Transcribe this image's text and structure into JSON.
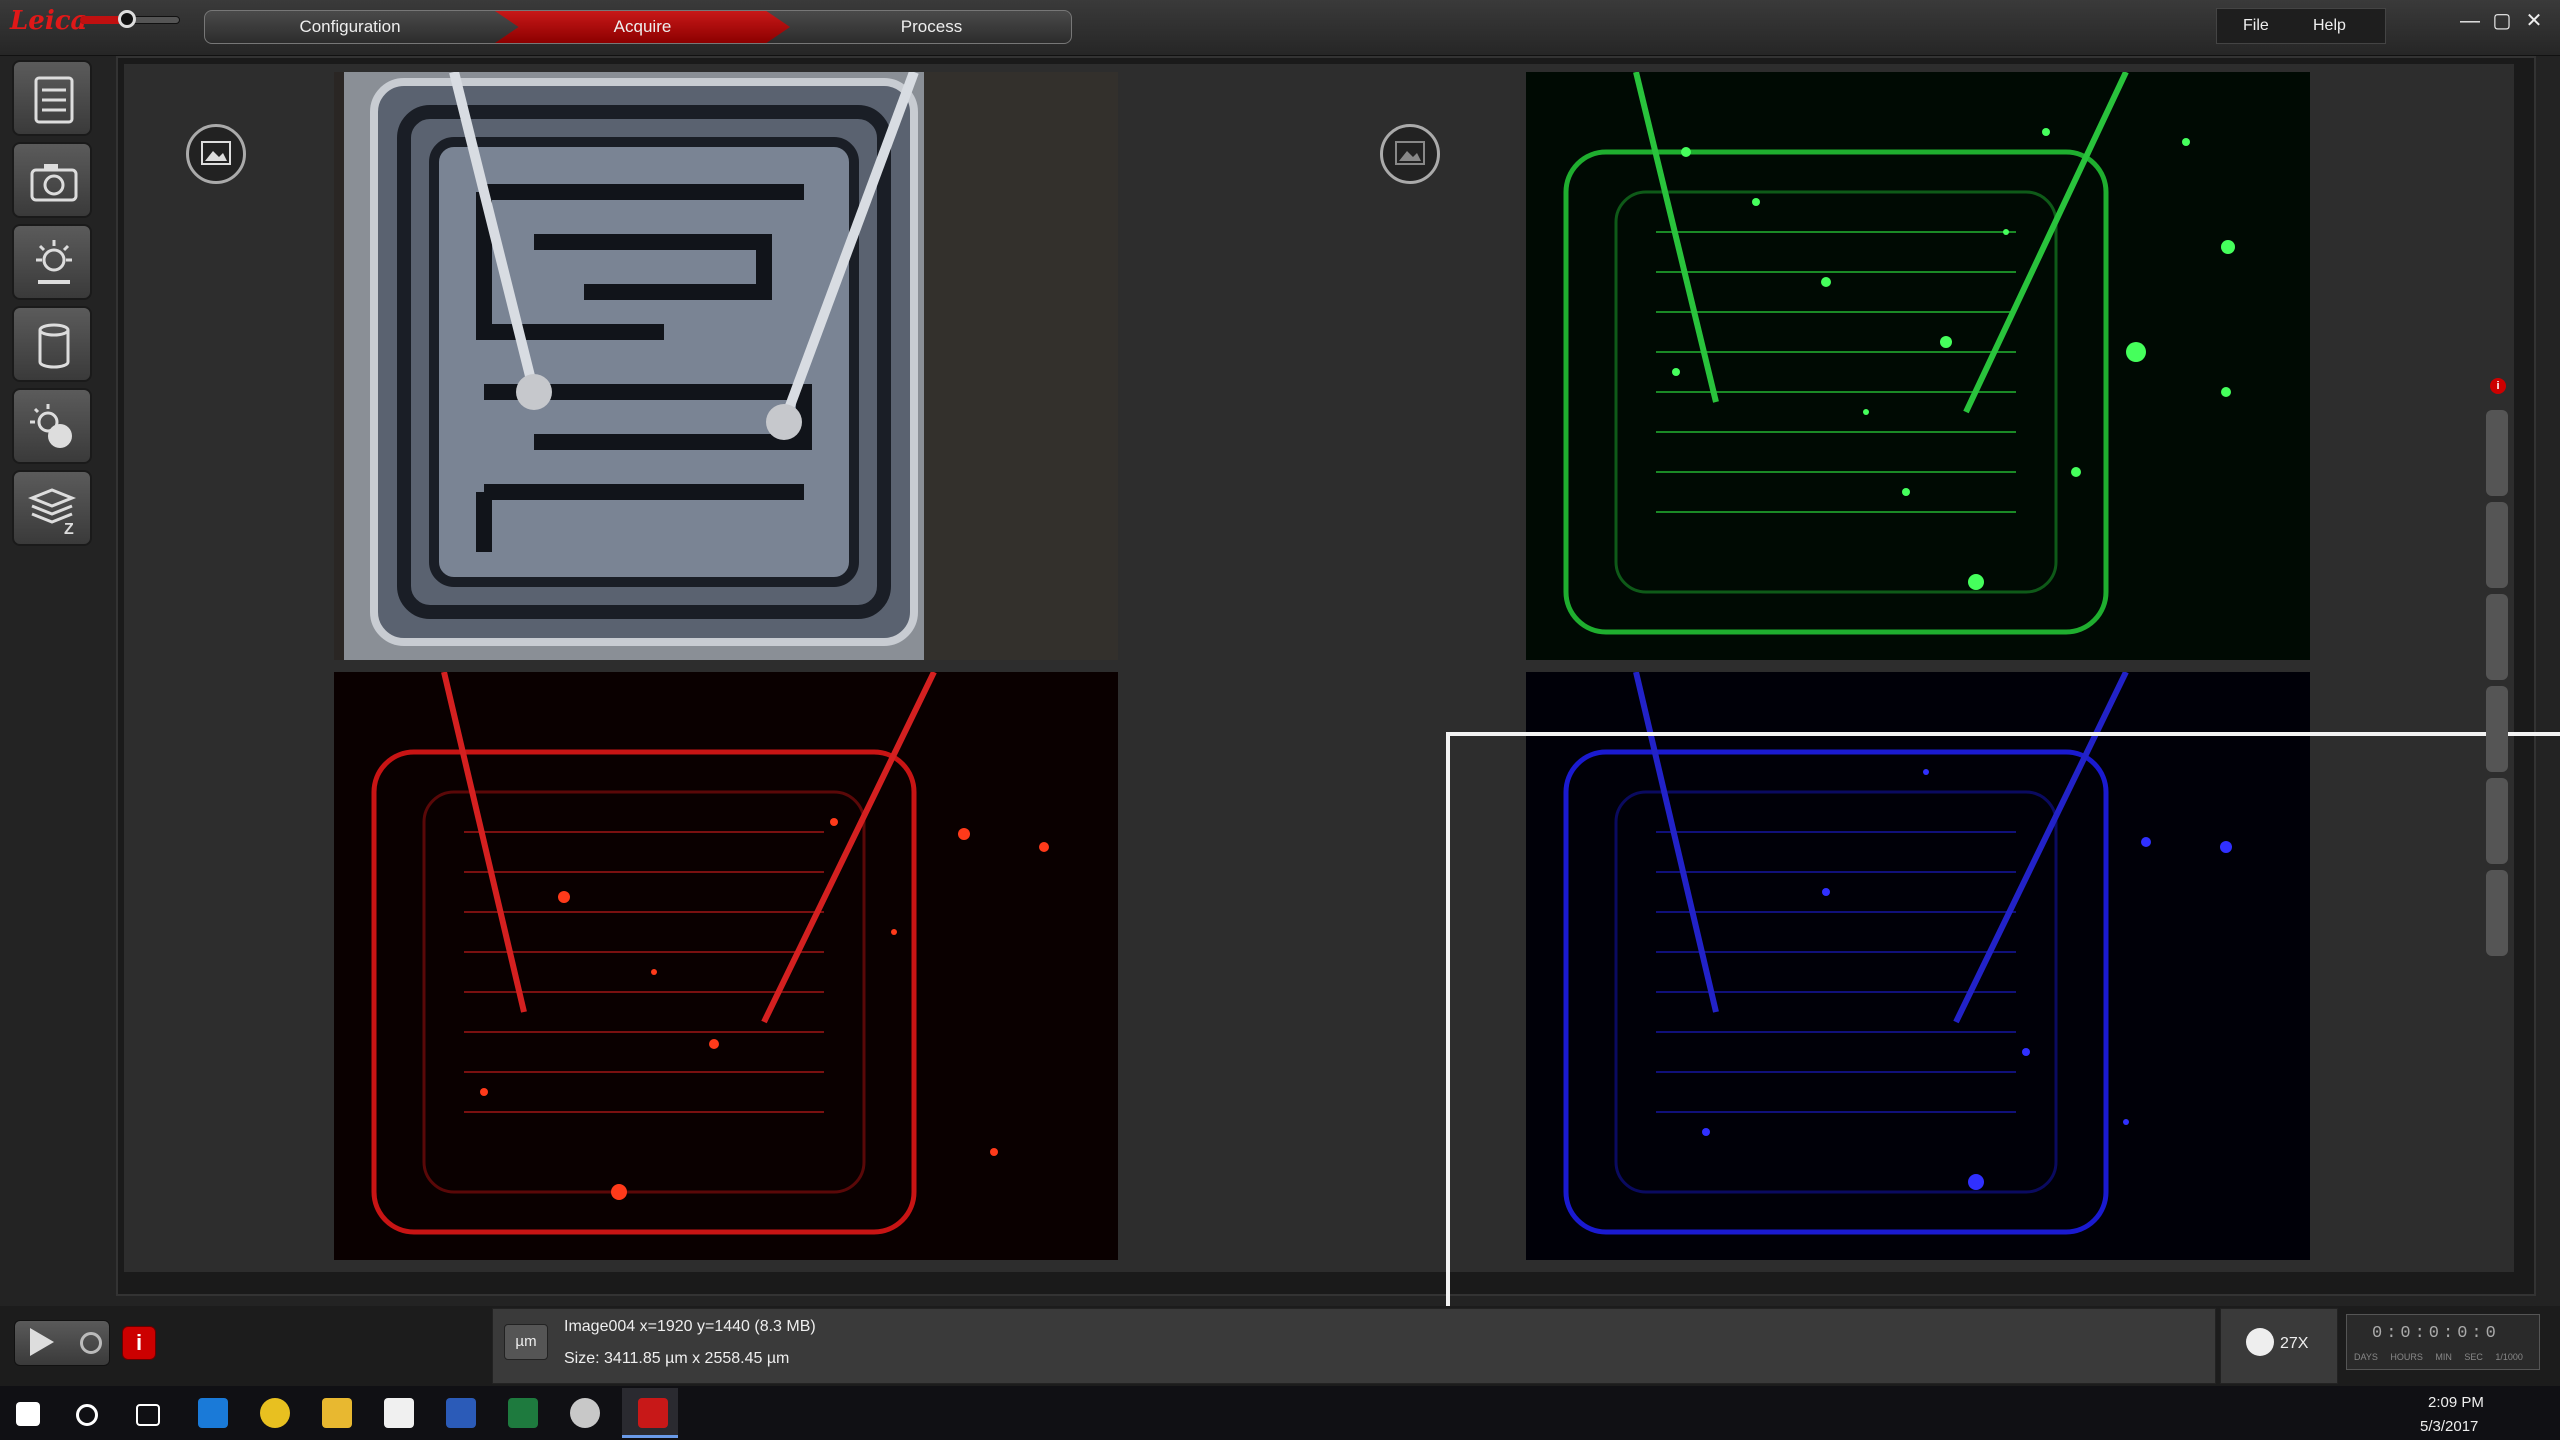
{
  "app": {
    "logo_text": "Leica",
    "workflow": [
      "Configuration",
      "Acquire",
      "Process"
    ],
    "menu": {
      "file": "File",
      "help": "Help"
    },
    "window_controls": {
      "minimize": "—",
      "maximize": "▢",
      "close": "✕"
    }
  },
  "tools": [
    "project-tree-icon",
    "camera-icon",
    "illumination-icon",
    "storage-icon",
    "fluorescence-icon",
    "z-stack-icon"
  ],
  "viewer": {
    "tiles": [
      {
        "channel": "brightfield",
        "color": "#9aa4b4"
      },
      {
        "channel": "green",
        "color": "#22d43a"
      },
      {
        "channel": "red",
        "color": "#e01818"
      },
      {
        "channel": "blue",
        "color": "#2020e0"
      }
    ],
    "selected_tile": "blue",
    "info_badge": "i"
  },
  "status": {
    "unit": "µm",
    "image_info": "Image004 x=1920 y=1440  (8.3 MB)",
    "image_size": "Size: 3411.85 µm x 2558.45 µm",
    "zoom": "27X",
    "timer": "0:0:0:0:0",
    "timer_labels": "DAYS HOURS MIN SEC 1/1000",
    "info_button": "i"
  },
  "taskbar": {
    "time": "2:09 PM",
    "date": "5/3/2017",
    "apps": [
      "windows-start",
      "cortana-search",
      "task-view",
      "edge",
      "chrome",
      "file-explorer",
      "store",
      "word",
      "excel",
      "paint",
      "leica-las-x"
    ]
  }
}
